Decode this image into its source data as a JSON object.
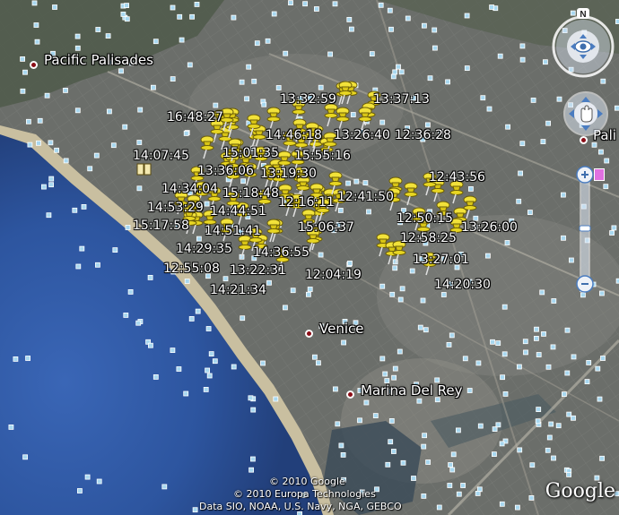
{
  "places": [
    {
      "name": "Pacific Palisades"
    },
    {
      "name": "Venice"
    },
    {
      "name": "Marina Del Rey"
    },
    {
      "name": "Pali"
    }
  ],
  "timestamps": [
    "13:32:59",
    "13:37:13",
    "16:48:27",
    "14:46:18",
    "13:26:40",
    "12:36:28",
    "15:01:35",
    "14:07:45",
    "15:55:16",
    "13:36:06",
    "13:19:30",
    "12:43:56",
    "14:34:04",
    "15:18:48",
    "12:41:50",
    "14:53:29",
    "14:44:51",
    "12:16:11",
    "12:50:15",
    "15:17:58",
    "15:06:37",
    "13:26:00",
    "14:51:41",
    "12:58:25",
    "14:29:35",
    "14:36:55",
    "13:27:01",
    "12:55:08",
    "13:22:31",
    "12:04:19",
    "14:20:30",
    "14:21:34"
  ],
  "attribution": {
    "line1": "© 2010 Google",
    "line2": "© 2010 Europa Technologies",
    "line3": "Data SIO, NOAA, U.S. Navy, NGA, GEBCO"
  },
  "logo": "Google",
  "compass_north": "N",
  "colors": {
    "ocean": "#2a4f9e",
    "beach": "#c9bfa0",
    "land": "#6b6e6a",
    "pin": "#e6d21a",
    "place_dot": "#8b0d16",
    "nav_control": "#d9e3ef"
  },
  "icons": {
    "placemark": "yellow-pushpin-icon",
    "photo": "photo-square-icon",
    "place": "red-dot-icon"
  }
}
